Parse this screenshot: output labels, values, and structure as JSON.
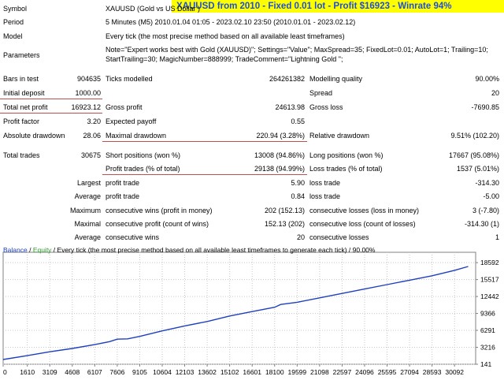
{
  "banner": {
    "symbol": "XAUUSD",
    "text": "from 2010 - Fixed 0.01 lot - Profit $16923 - Winrate 94%"
  },
  "report": {
    "symbol_label": "Symbol",
    "symbol_value": "XAUUSD (Gold vs US Dollar )",
    "period_label": "Period",
    "period_value": "5 Minutes (M5) 2010.01.04 01:05 - 2023.02.10 23:50 (2010.01.01 - 2023.02.12)",
    "model_label": "Model",
    "model_value": "Every tick (the most precise method based on all available least timeframes)",
    "parameters_label": "Parameters",
    "parameters_line1": "Note=\"Expert works best with Gold (XAUUSD)\"; Settings=\"Value\"; MaxSpread=35; FixedLot=0.01; AutoLot=1; Trailing=10;",
    "parameters_line2": "StartTrailing=30; MagicNumber=888999; TradeComment=\"Lightning Gold \";",
    "bars_label": "Bars in test",
    "bars_value": "904635",
    "ticks_label": "Ticks modelled",
    "ticks_value": "264261382",
    "quality_label": "Modelling quality",
    "quality_value": "90.00%",
    "deposit_label": "Initial deposit",
    "deposit_value": "1000.00",
    "spread_label": "Spread",
    "spread_value": "20",
    "net_label": "Total net profit",
    "net_value": "16923.12",
    "gross_profit_label": "Gross profit",
    "gross_profit_value": "24613.98",
    "gross_loss_label": "Gross loss",
    "gross_loss_value": "-7690.85",
    "pf_label": "Profit factor",
    "pf_value": "3.20",
    "payoff_label": "Expected payoff",
    "payoff_value": "0.55",
    "abs_dd_label": "Absolute drawdown",
    "abs_dd_value": "28.06",
    "max_dd_label": "Maximal drawdown",
    "max_dd_value": "220.94 (3.28%)",
    "rel_dd_label": "Relative drawdown",
    "rel_dd_value": "9.51% (102.20)",
    "trades_label": "Total trades",
    "trades_value": "30675",
    "short_label": "Short positions (won %)",
    "short_value": "13008 (94.86%)",
    "long_label": "Long positions (won %)",
    "long_value": "17667 (95.08%)",
    "profit_trades_label": "Profit trades (% of total)",
    "profit_trades_value": "29138 (94.99%)",
    "loss_trades_label": "Loss trades (% of total)",
    "loss_trades_value": "1537 (5.01%)",
    "largest_label": "Largest",
    "largest_profit_label": "profit trade",
    "largest_profit_value": "5.90",
    "largest_loss_label": "loss trade",
    "largest_loss_value": "-314.30",
    "average_label": "Average",
    "average_profit_label": "profit trade",
    "average_profit_value": "0.84",
    "average_loss_label": "loss trade",
    "average_loss_value": "-5.00",
    "maximum_label": "Maximum",
    "max_cons_wins_label": "consecutive wins (profit in money)",
    "max_cons_wins_value": "202 (152.13)",
    "max_cons_losses_label": "consecutive losses (loss in money)",
    "max_cons_losses_value": "3 (-7.80)",
    "maximal_label": "Maximal",
    "maximal_cons_profit_label": "consecutive profit (count of wins)",
    "maximal_cons_profit_value": "152.13 (202)",
    "maximal_cons_loss_label": "consecutive loss (count of losses)",
    "maximal_cons_loss_value": "-314.30 (1)",
    "avg2_label": "Average",
    "avg_cons_wins_label": "consecutive wins",
    "avg_cons_wins_value": "20",
    "avg_cons_losses_label": "consecutive losses",
    "avg_cons_losses_value": "1"
  },
  "chart_header": {
    "balance": "Balance",
    "sep": " / ",
    "equity": "Equity",
    "rest": " / Every tick (the most precise method based on all available least timeframes to generate each tick) / 90.00%"
  },
  "colors": {
    "balance": "#1f3fbf",
    "equity": "#2e9b2e",
    "grid": "#c8c8c8",
    "banner_bg": "#ffff00",
    "banner_text": "#1f4fd8"
  },
  "chart_data": {
    "type": "line",
    "title": "",
    "xlabel": "",
    "ylabel": "",
    "xlim": [
      0,
      31500
    ],
    "ylim": [
      141,
      19900
    ],
    "x_ticks": [
      0,
      1610,
      3109,
      4608,
      6107,
      7606,
      9105,
      10604,
      12103,
      13602,
      15102,
      16601,
      18100,
      19599,
      21098,
      22597,
      24096,
      25595,
      27094,
      28593,
      30092
    ],
    "y_ticks": [
      141,
      3216,
      6291,
      9366,
      12442,
      15517,
      18592
    ],
    "grid": true,
    "series": [
      {
        "name": "Balance",
        "x": [
          0,
          1610,
          3109,
          4608,
          6107,
          7100,
          7606,
          8300,
          9105,
          10604,
          12103,
          13602,
          15102,
          16601,
          18100,
          18500,
          19599,
          21098,
          22597,
          24096,
          25595,
          27094,
          28593,
          30092,
          31000
        ],
        "y": [
          1000,
          1700,
          2400,
          3000,
          3700,
          4250,
          4700,
          4750,
          5200,
          6200,
          7100,
          7900,
          8900,
          9700,
          10500,
          11000,
          11400,
          12200,
          13000,
          13800,
          14600,
          15400,
          16200,
          17200,
          17900
        ]
      }
    ]
  }
}
